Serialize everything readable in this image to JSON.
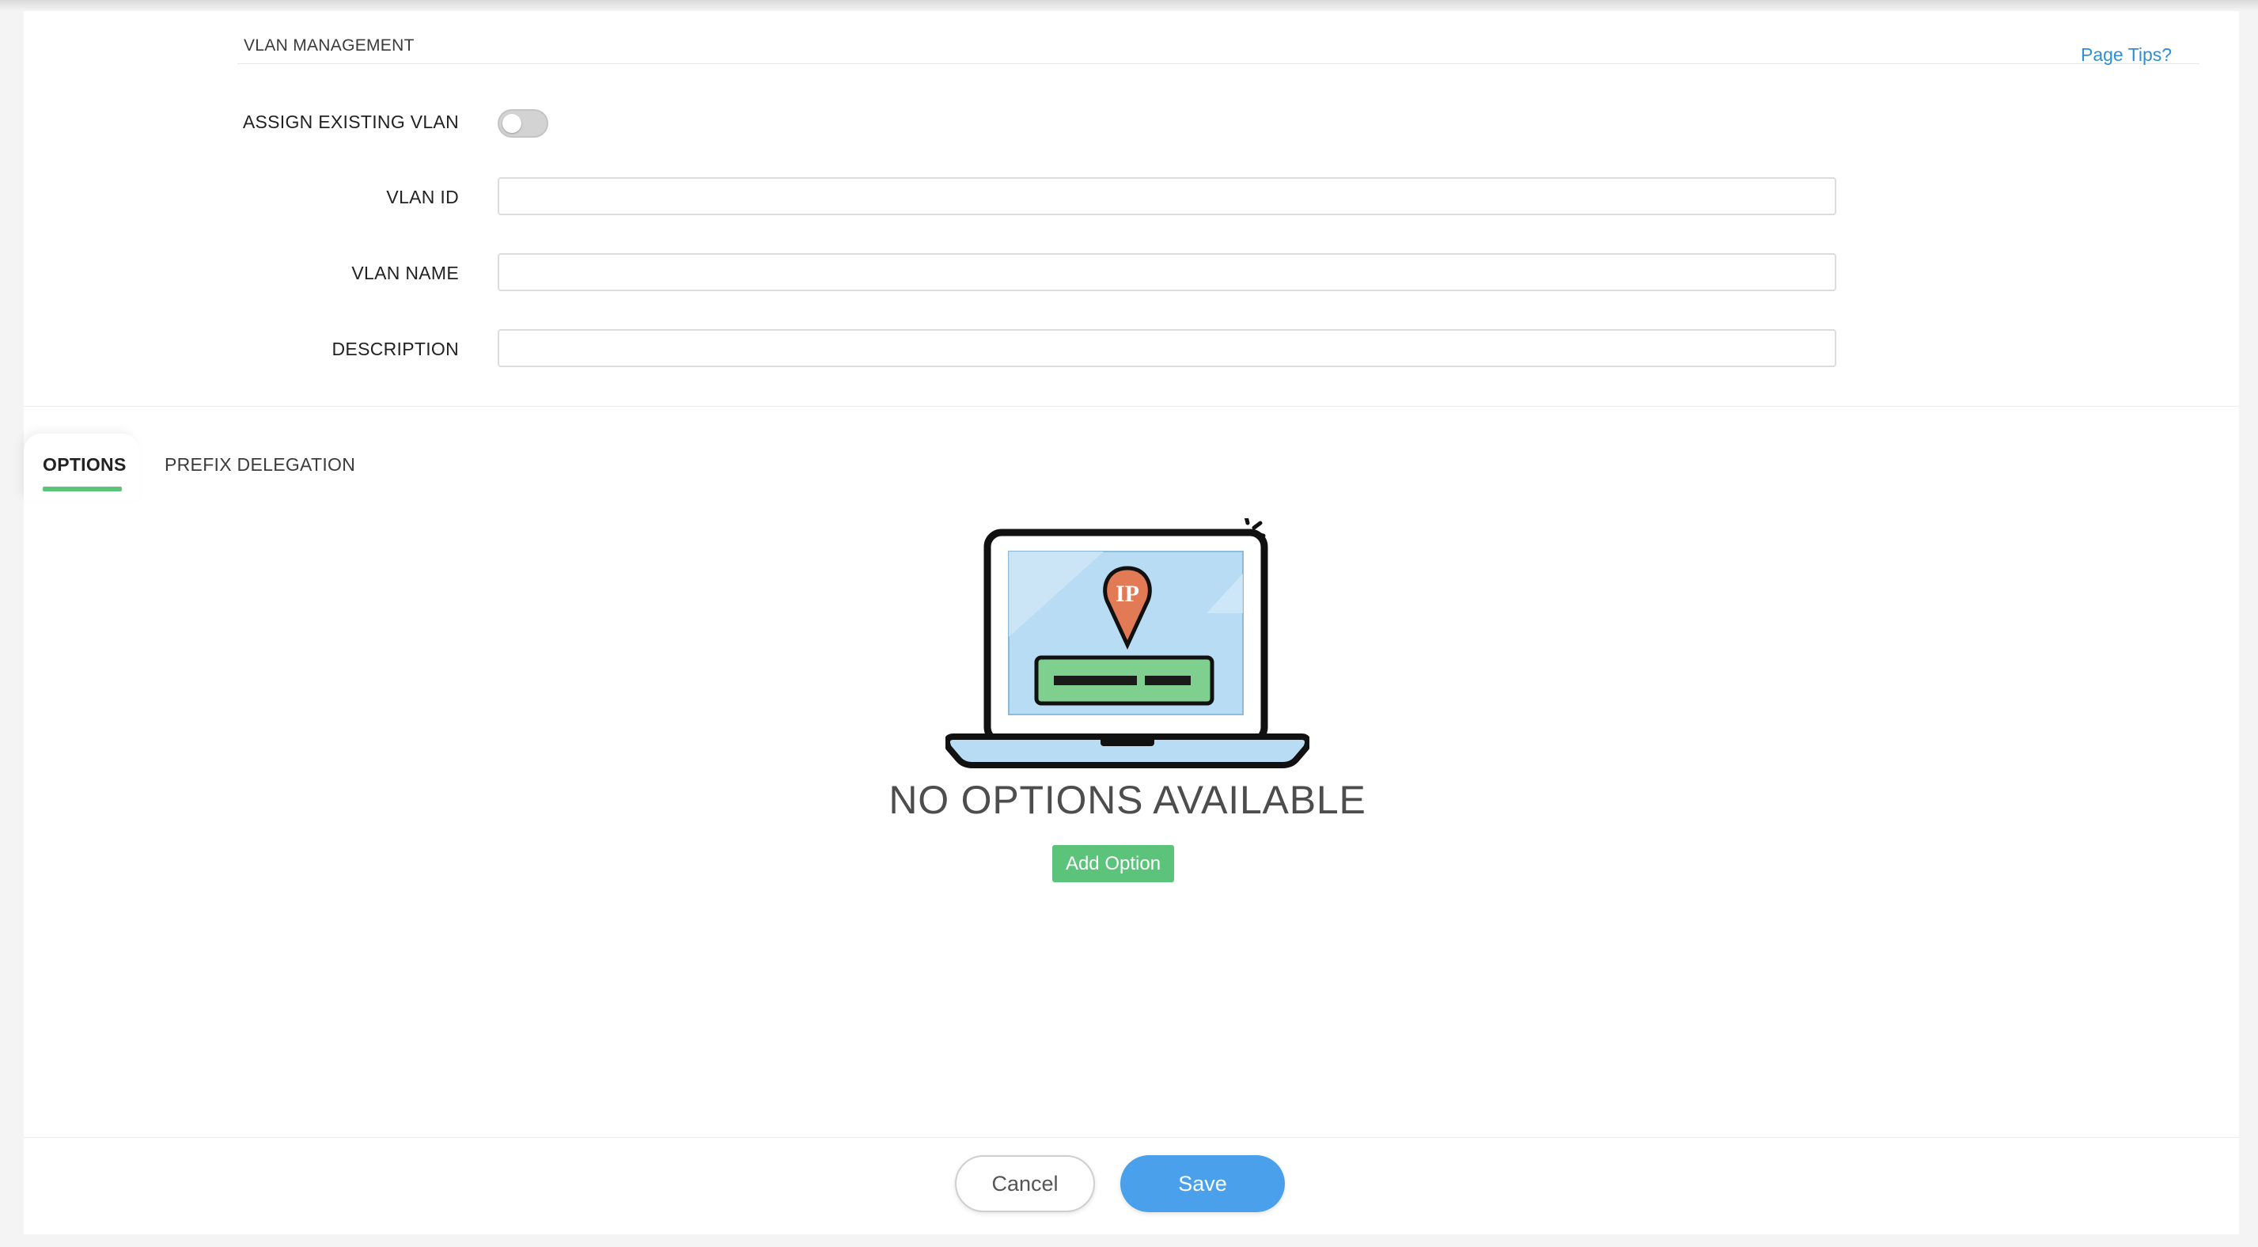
{
  "header": {
    "section_title": "VLAN MANAGEMENT",
    "page_tips_link": "Page Tips?"
  },
  "form": {
    "assign_existing_vlan": {
      "label": "ASSIGN EXISTING VLAN",
      "enabled": false
    },
    "vlan_id": {
      "label": "VLAN ID",
      "value": ""
    },
    "vlan_name": {
      "label": "VLAN NAME",
      "value": ""
    },
    "description": {
      "label": "DESCRIPTION",
      "value": ""
    }
  },
  "tabs": [
    {
      "label": "OPTIONS",
      "active": true
    },
    {
      "label": "PREFIX DELEGATION",
      "active": false
    }
  ],
  "empty_state": {
    "illustration_icon": "laptop-ip-pin-icon",
    "illustration_text": "IP",
    "title": "NO OPTIONS AVAILABLE",
    "add_button_label": "Add Option"
  },
  "footer": {
    "cancel_label": "Cancel",
    "save_label": "Save"
  },
  "colors": {
    "accent_green": "#5cc37a",
    "accent_blue": "#4aa0ea",
    "link_blue": "#2d8fd6",
    "pin_orange": "#e27a55"
  }
}
